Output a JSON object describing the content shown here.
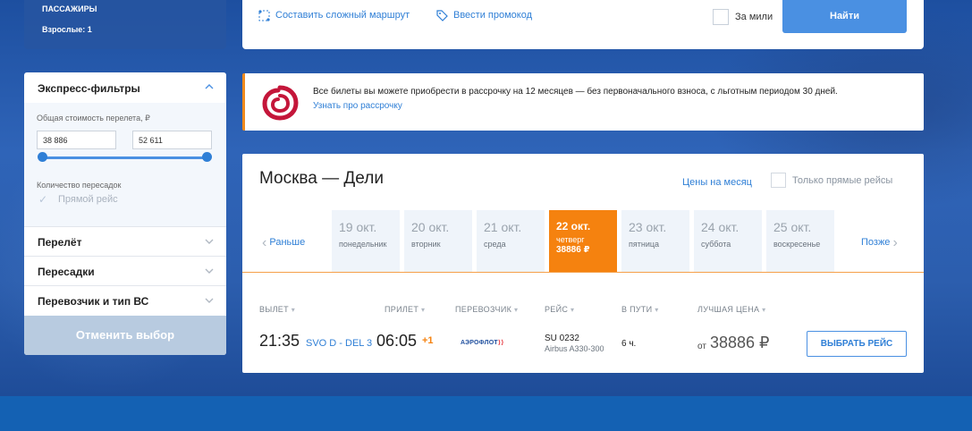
{
  "passengers": {
    "label": "ПАССАЖИРЫ",
    "value": "Взрослые: 1"
  },
  "searchbar": {
    "complex_route": "Составить сложный маршрут",
    "promo": "Ввести промокод",
    "miles_label": "За мили",
    "find_button": "Найти"
  },
  "filters": {
    "express_title": "Экспресс-фильтры",
    "price_label": "Общая стоимость перелета, ₽",
    "price_min": "38 886",
    "price_max": "52 611",
    "stops_label": "Количество пересадок",
    "direct_label": "Прямой рейс",
    "sections": [
      "Перелёт",
      "Пересадки",
      "Перевозчик и тип ВС"
    ],
    "reset_button": "Отменить выбор"
  },
  "banner": {
    "text": "Все билеты вы можете приобрести в рассрочку на 12 месяцев — без первоначального взноса, с льготным периодом 30 дней.",
    "link": "Узнать про рассрочку"
  },
  "results": {
    "route": "Москва — Дели",
    "month_prices": "Цены на месяц",
    "direct_only": "Только прямые рейсы",
    "prev": "Раньше",
    "next": "Позже",
    "days": [
      {
        "date": "19 окт.",
        "weekday": "понедельник"
      },
      {
        "date": "20 окт.",
        "weekday": "вторник"
      },
      {
        "date": "21 окт.",
        "weekday": "среда"
      },
      {
        "date": "22 окт.",
        "weekday": "четверг",
        "price": "38886 ₽"
      },
      {
        "date": "23 окт.",
        "weekday": "пятница"
      },
      {
        "date": "24 окт.",
        "weekday": "суббота"
      },
      {
        "date": "25 окт.",
        "weekday": "воскресенье"
      }
    ],
    "columns": {
      "departure": "ВЫЛЕТ",
      "arrival": "ПРИЛЕТ",
      "carrier": "ПЕРЕВОЗЧИК",
      "flight": "РЕЙС",
      "duration": "В ПУТИ",
      "best_price": "ЛУЧШАЯ ЦЕНА"
    },
    "flight": {
      "dep_time": "21:35",
      "airports": "SVO D - DEL 3",
      "arr_time": "06:05",
      "day_offset": "+1",
      "airline": "АЭРОФЛОТ",
      "number": "SU 0232",
      "aircraft": "Airbus A330-300",
      "duration": "6 ч.",
      "price_prefix": "от",
      "price": "38886 ₽",
      "choose_button": "ВЫБРАТЬ РЕЙС"
    }
  },
  "colors": {
    "accent": "#4a90e2",
    "selected_day": "#f5820f",
    "link": "#2f7fd6"
  }
}
